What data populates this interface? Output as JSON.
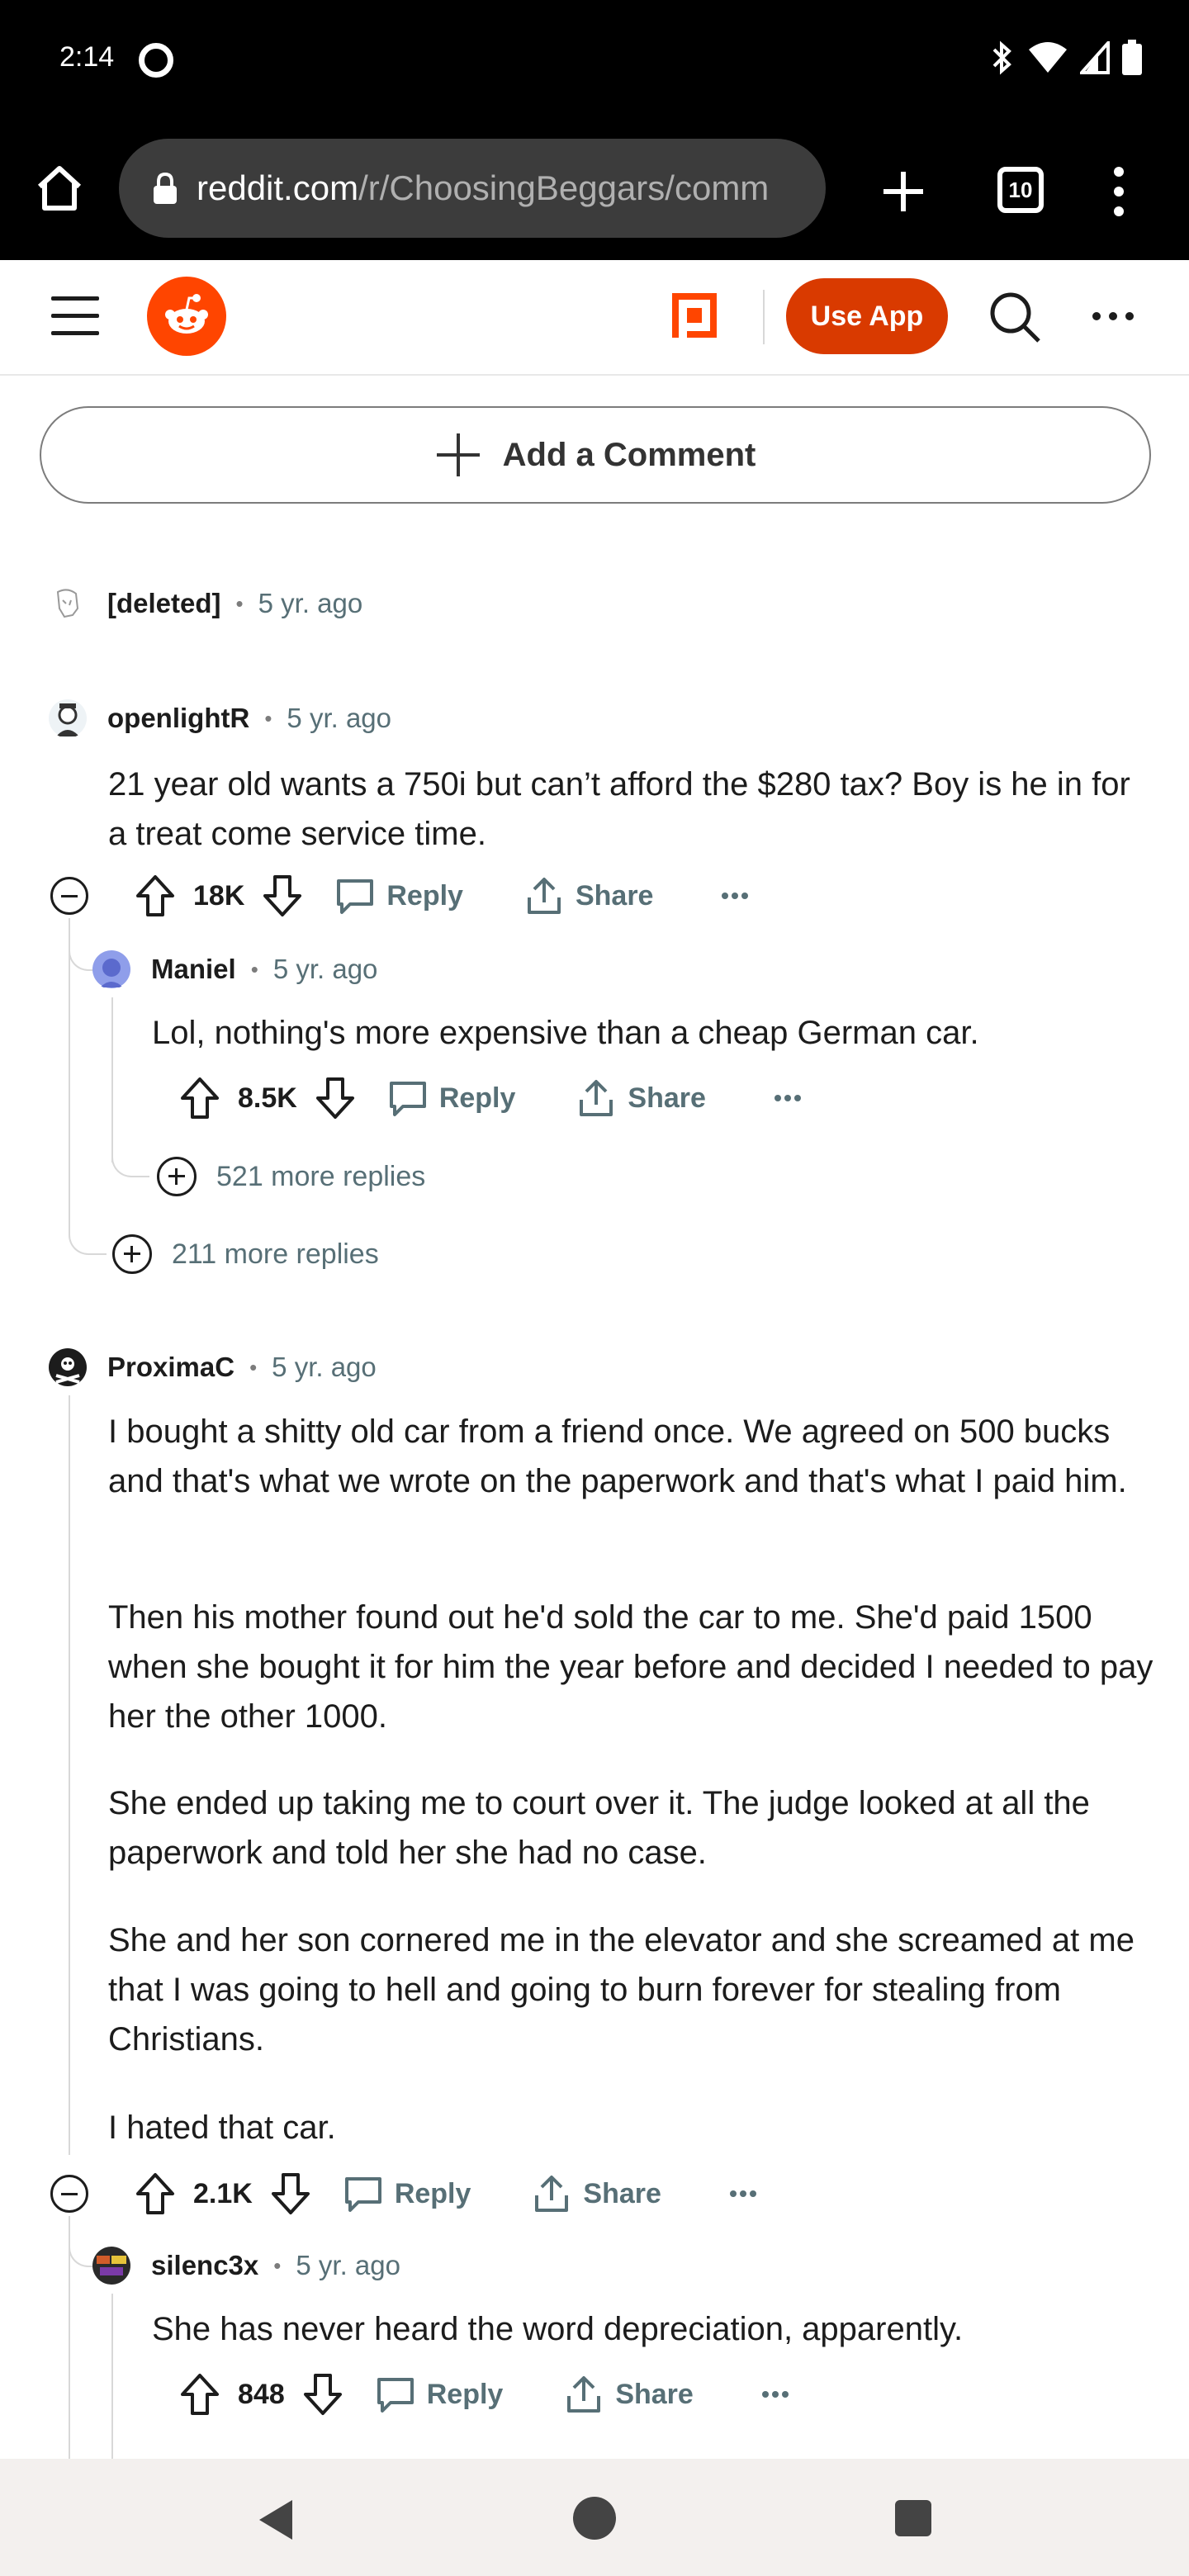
{
  "status_bar": {
    "time": "2:14"
  },
  "browser": {
    "url_domain": "reddit.com",
    "url_path": "/r/ChoosingBeggars/comm",
    "tab_count": "10"
  },
  "reddit_header": {
    "use_app_label": "Use App"
  },
  "add_comment_label": "Add a Comment",
  "comments": [
    {
      "author": "[deleted]",
      "age": "5 yr. ago"
    },
    {
      "author": "openlightR",
      "age": "5 yr. ago",
      "body": "21 year old wants a 750i but can’t afford the $280 tax? Boy is he in for a treat come service time.",
      "score": "18K",
      "reply_label": "Reply",
      "share_label": "Share",
      "more_replies": "211 more replies"
    },
    {
      "author": "Maniel",
      "age": "5 yr. ago",
      "body": "Lol, nothing's more expensive than a cheap German car.",
      "score": "8.5K",
      "reply_label": "Reply",
      "share_label": "Share",
      "more_replies": "521 more replies"
    },
    {
      "author": "ProximaC",
      "age": "5 yr. ago",
      "paragraphs": [
        "I bought a shitty old car from a friend once. We agreed on 500 bucks and that's what we wrote on the paperwork and that's what I paid him.",
        "Then his mother found out he'd sold the car to me. She'd paid 1500 when she bought it for him the year before and decided I needed to pay her the other 1000.",
        "She ended up taking me to court over it. The judge looked at all the paperwork and told her she had no case.",
        "She and her son cornered me in the elevator and she screamed at me that I was going to hell and going to burn forever for stealing from Christians.",
        "I hated that car."
      ],
      "score": "2.1K",
      "reply_label": "Reply",
      "share_label": "Share"
    },
    {
      "author": "silenc3x",
      "age": "5 yr. ago",
      "body": "She has never heard the word depreciation, apparently.",
      "score": "848",
      "reply_label": "Reply",
      "share_label": "Share"
    }
  ],
  "colors": {
    "reddit_orange": "#ff4500",
    "use_app_bg": "#d93a00",
    "meta_gray": "#576f76"
  }
}
